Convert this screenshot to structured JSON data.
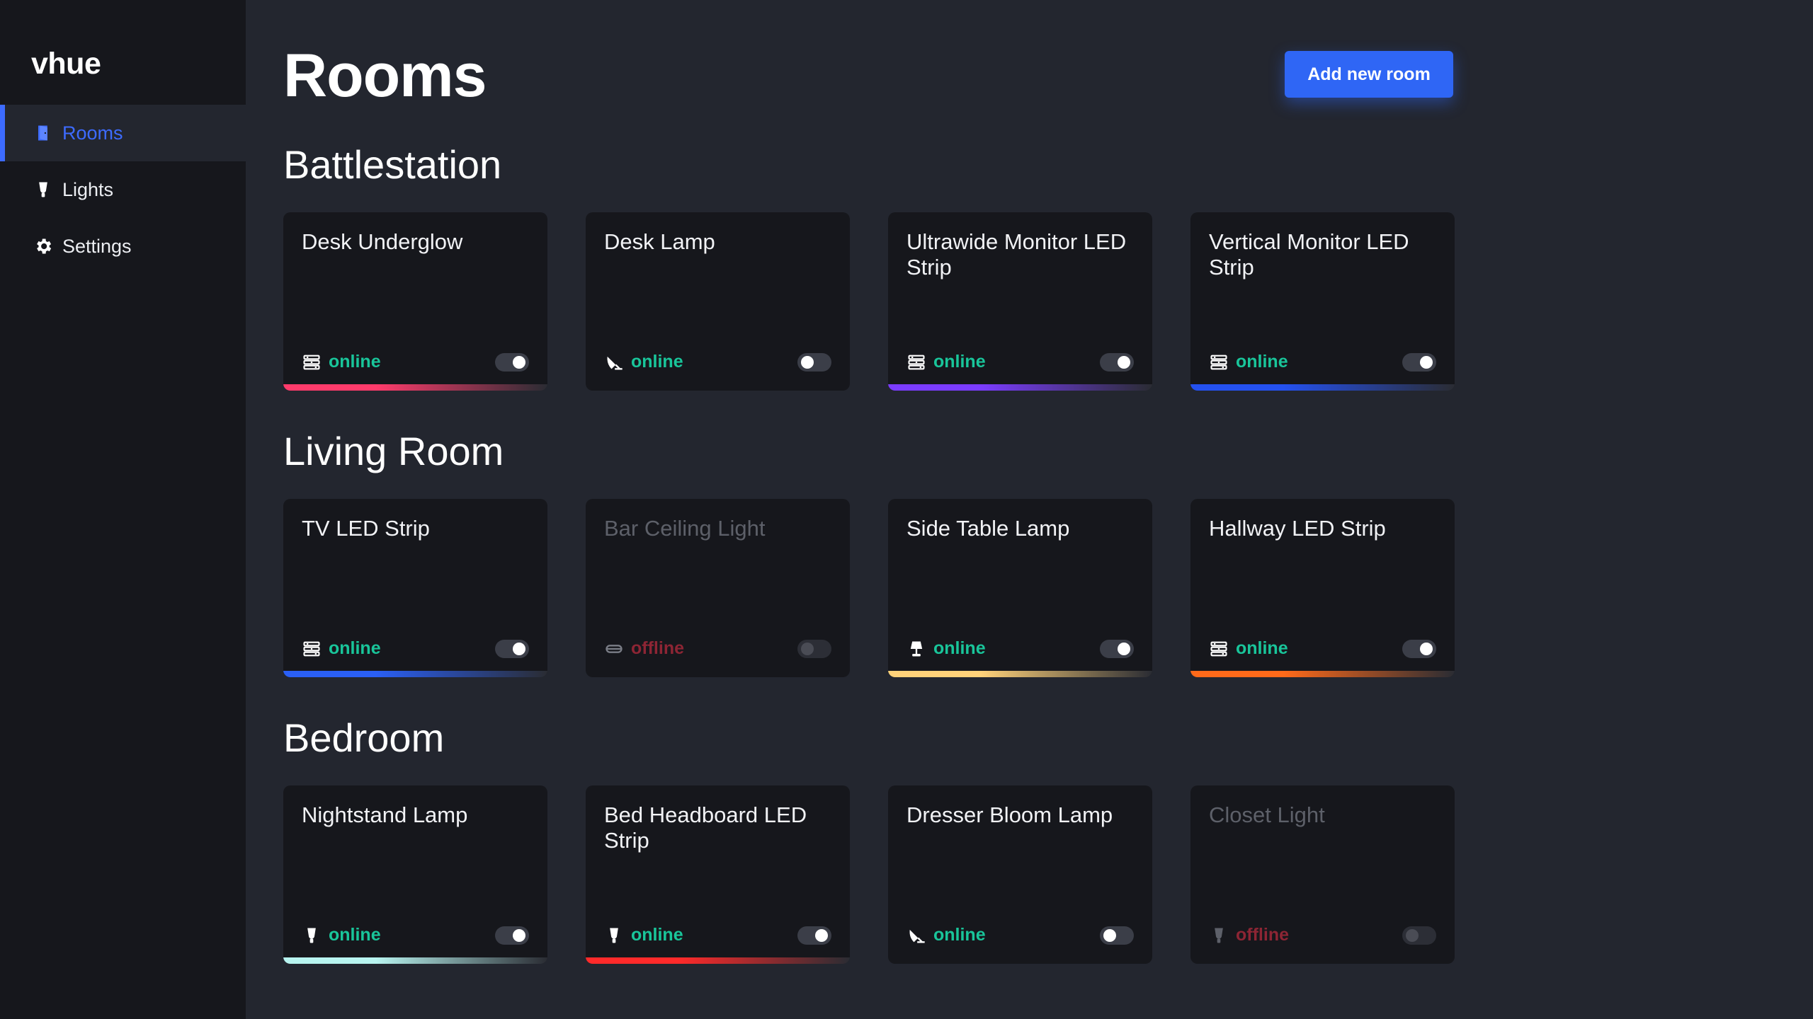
{
  "app": {
    "name": "vhue"
  },
  "sidebar": {
    "items": [
      {
        "label": "Rooms",
        "icon": "door-icon",
        "active": true
      },
      {
        "label": "Lights",
        "icon": "bulb-icon",
        "active": false
      },
      {
        "label": "Settings",
        "icon": "gear-icon",
        "active": false
      }
    ]
  },
  "page": {
    "title": "Rooms",
    "add_button": "Add new room"
  },
  "rooms": [
    {
      "name": "Battlestation",
      "lights": [
        {
          "name": "Desk Underglow",
          "icon": "led-strip-icon",
          "status": "online",
          "on": true,
          "color": "#ff3b6b"
        },
        {
          "name": "Desk Lamp",
          "icon": "desk-lamp-icon",
          "status": "online",
          "on": false,
          "color": null
        },
        {
          "name": "Ultrawide Monitor LED Strip",
          "icon": "led-strip-icon",
          "status": "online",
          "on": true,
          "color": "#7b3cff"
        },
        {
          "name": "Vertical Monitor LED Strip",
          "icon": "led-strip-icon",
          "status": "online",
          "on": true,
          "color": "#2451f0"
        }
      ]
    },
    {
      "name": "Living Room",
      "lights": [
        {
          "name": "TV LED Strip",
          "icon": "led-strip-icon",
          "status": "online",
          "on": true,
          "color": "#2a5ff5"
        },
        {
          "name": "Bar Ceiling Light",
          "icon": "ceiling-light-icon",
          "status": "offline",
          "on": false,
          "color": null
        },
        {
          "name": "Side Table Lamp",
          "icon": "table-lamp-icon",
          "status": "online",
          "on": true,
          "color": "#ffd27a"
        },
        {
          "name": "Hallway LED Strip",
          "icon": "led-strip-icon",
          "status": "online",
          "on": true,
          "color": "#ff6a1a"
        }
      ]
    },
    {
      "name": "Bedroom",
      "lights": [
        {
          "name": "Nightstand Lamp",
          "icon": "bulb-icon",
          "status": "online",
          "on": true,
          "color": "#b8f4f0"
        },
        {
          "name": "Bed Headboard LED Strip",
          "icon": "bulb-icon",
          "status": "online",
          "on": true,
          "color": "#ff2a2a"
        },
        {
          "name": "Dresser Bloom Lamp",
          "icon": "desk-lamp-icon",
          "status": "online",
          "on": false,
          "color": null
        },
        {
          "name": "Closet Light",
          "icon": "bulb-icon",
          "status": "offline",
          "on": false,
          "color": null
        }
      ]
    }
  ]
}
